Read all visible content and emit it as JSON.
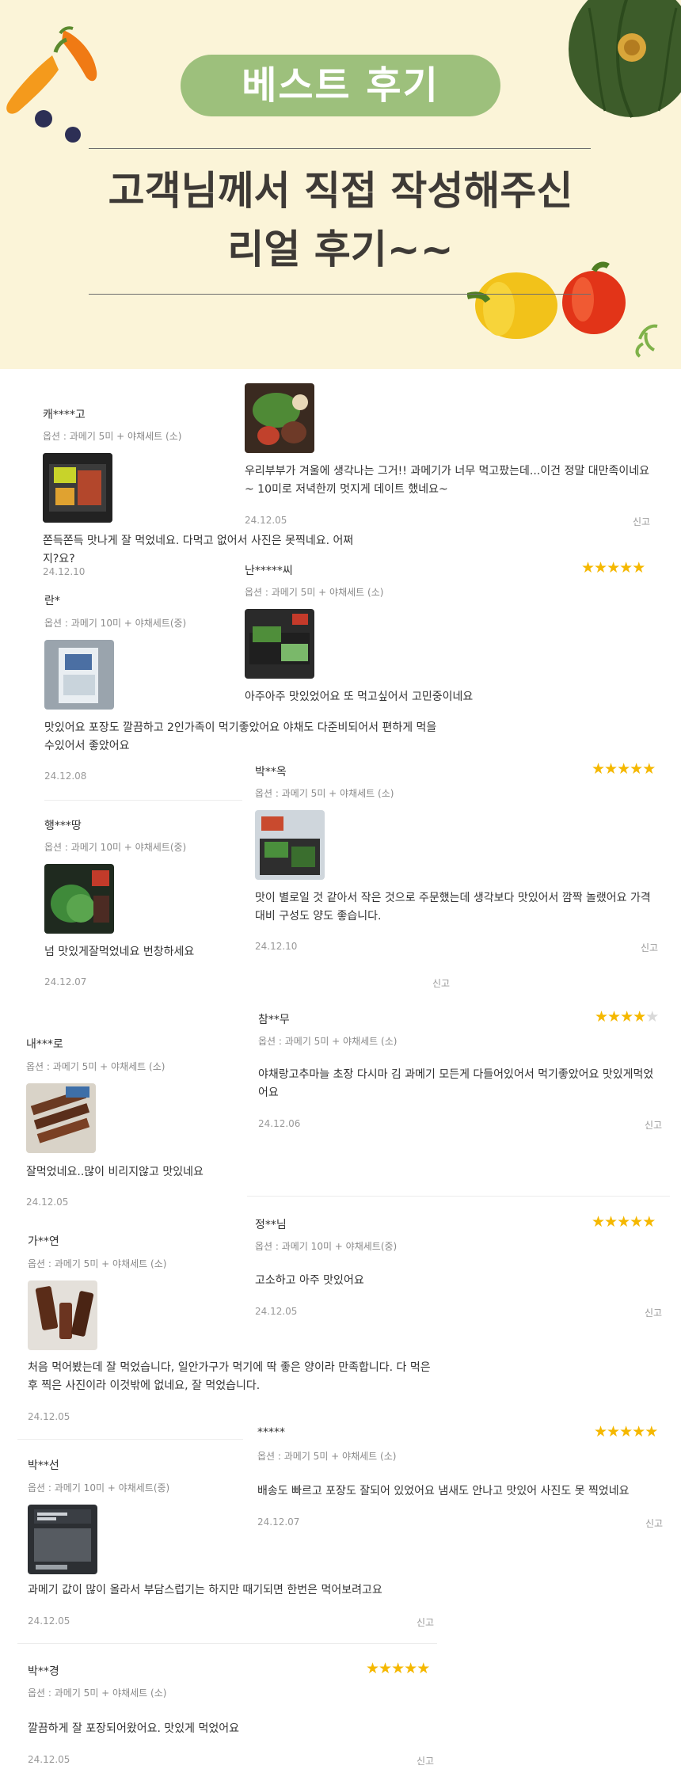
{
  "header": {
    "badge": "베스트 후기",
    "line1": "고객님께서 직접 작성해주신",
    "line2": "리얼 후기~~"
  },
  "colors": {
    "badge_bg": "#9dc07c",
    "hero_bg": "#fbf4d8",
    "star": "#f5b800"
  },
  "reviews": [
    {
      "author": "캐****고",
      "option": "옵션 : 과메기 5미 + 야채세트 (소)",
      "text": "쫀득쫀득 맛나게 잘 먹었네요. 다먹고 없어서 사진은 못찍네요. 어쩌지?요?",
      "date": "24.12.10"
    },
    {
      "author": "",
      "option": "",
      "text": "우리부부가 겨울에 생각나는 그거!! 과메기가 너무 먹고팠는데...이건 정말 대만족이네요~ 10미로 저녁한끼 멋지게 데이트 했네요~",
      "date": "24.12.05",
      "report": "신고"
    },
    {
      "author": "난*****씨",
      "option": "옵션 : 과메기 5미 + 야채세트 (소)",
      "text": "아주아주 맛있었어요 또 먹고싶어서 고민중이네요",
      "stars": 5
    },
    {
      "author": "란*",
      "option": "옵션 : 과메기 10미 + 야채세트(중)",
      "text": "맛있어요 포장도 깔끔하고 2인가족이 먹기좋았어요 야채도 다준비되어서 편하게 먹을수있어서 좋았어요",
      "date": "24.12.08"
    },
    {
      "author": "박**옥",
      "option": "옵션 : 과메기 5미 + 야채세트 (소)",
      "text": "맛이 별로일 것 같아서 작은 것으로 주문했는데 생각보다 맛있어서 깜짝 놀랬어요 가격대비 구성도 양도 좋습니다.",
      "date": "24.12.10",
      "report": "신고",
      "stars": 5
    },
    {
      "author": "행***땅",
      "option": "옵션 : 과메기 10미 + 야채세트(중)",
      "text": "넘 맛있게잘먹었네요 번창하세요",
      "date": "24.12.07",
      "report": "신고"
    },
    {
      "author": "참**무",
      "option": "옵션 : 과메기 5미 + 야채세트 (소)",
      "text": "야채랑고추마늘 초장 다시마 김 과메기 모든게 다들어있어서 먹기좋았어요 맛있게먹었어요",
      "date": "24.12.06",
      "report": "신고",
      "stars": 4
    },
    {
      "author": "내***로",
      "option": "옵션 : 과메기 5미 + 야채세트 (소)",
      "text": "잘먹었네요..많이 비리지않고 맛있네요",
      "date": "24.12.05"
    },
    {
      "author": "정**님",
      "option": "옵션 : 과메기 10미 + 야채세트(중)",
      "text": "고소하고 아주 맛있어요",
      "date": "24.12.05",
      "report": "신고",
      "stars": 5
    },
    {
      "author": "가**연",
      "option": "옵션 : 과메기 5미 + 야채세트 (소)",
      "text": "처음 먹어봤는데 잘 먹었습니다, 일안가구가 먹기에 딱 좋은 양이라 만족합니다. 다 먹은후 찍은 사진이라 이것밖에 없네요, 잘 먹었습니다.",
      "date": "24.12.05"
    },
    {
      "author": "*****",
      "option": "옵션 : 과메기 5미 + 야채세트 (소)",
      "text": "배송도 빠르고 포장도 잘되어 있었어요 냄새도 안나고 맛있어 사진도 못 찍었네요",
      "date": "24.12.07",
      "report": "신고",
      "stars": 5
    },
    {
      "author": "박**선",
      "option": "옵션 : 과메기 10미 + 야채세트(중)",
      "text": "과메기 값이 많이 올라서 부담스럽기는 하지만 때기되면 한번은 먹어보려고요",
      "date": "24.12.05",
      "report": "신고"
    },
    {
      "author": "박**경",
      "option": "옵션 : 과메기 5미 + 야채세트 (소)",
      "text": "깔끔하게 잘 포장되어왔어요. 맛있게 먹었어요",
      "date": "24.12.05",
      "report": "신고",
      "stars": 5
    }
  ]
}
